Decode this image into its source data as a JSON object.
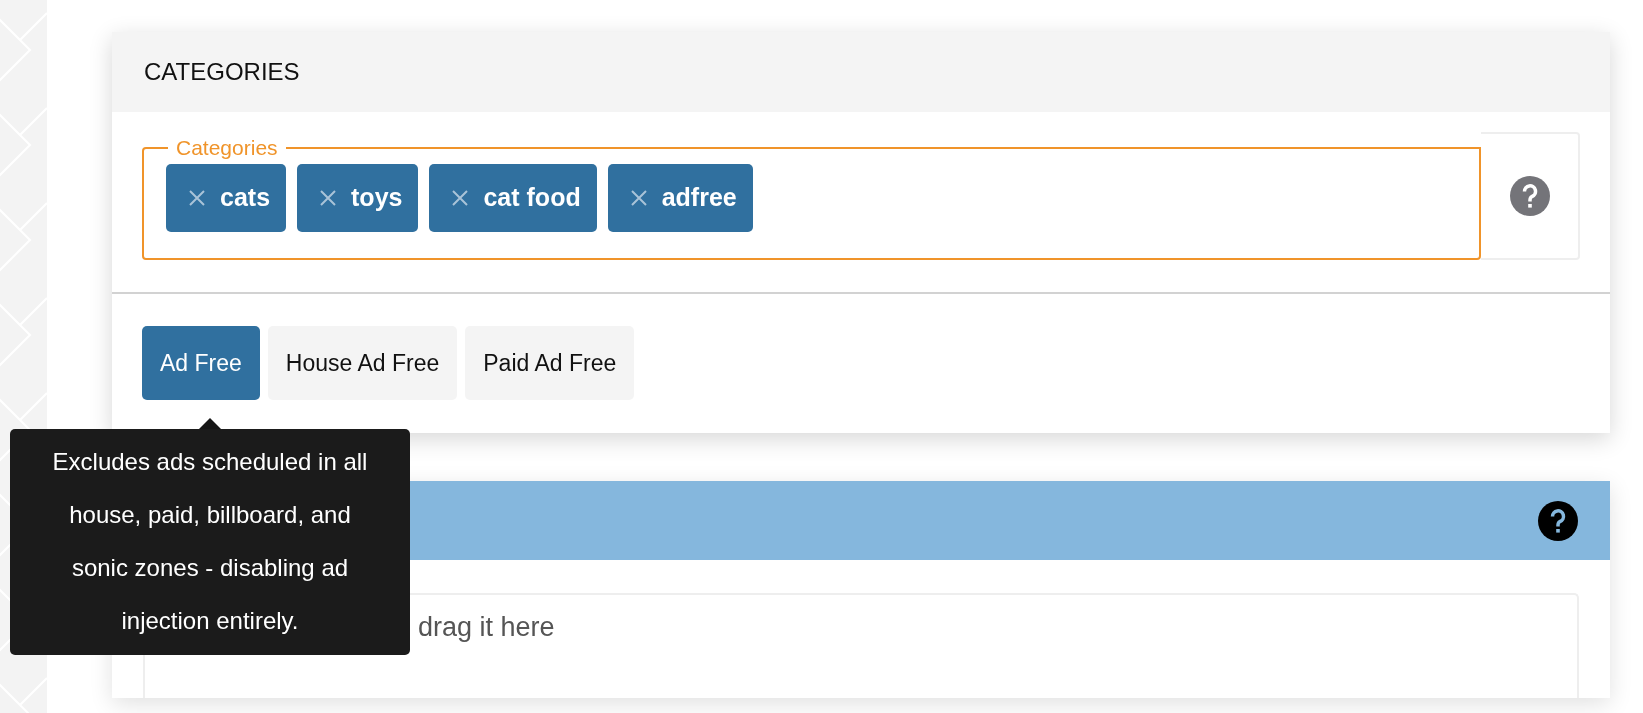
{
  "categories_card": {
    "title": "CATEGORIES",
    "field": {
      "legend": "Categories",
      "focused": true,
      "tags": [
        {
          "label": "cats"
        },
        {
          "label": "toys"
        },
        {
          "label": "cat food"
        },
        {
          "label": "adfree"
        }
      ]
    },
    "options": [
      {
        "label": "Ad Free",
        "selected": true
      },
      {
        "label": "House Ad Free",
        "selected": false
      },
      {
        "label": "Paid Ad Free",
        "selected": false
      }
    ]
  },
  "tooltip": {
    "text": "Excludes ads scheduled in all house, paid, billboard, and sonic zones - disabling ad injection entirely."
  },
  "cover_card": {
    "upload_text": "drag it here"
  }
}
